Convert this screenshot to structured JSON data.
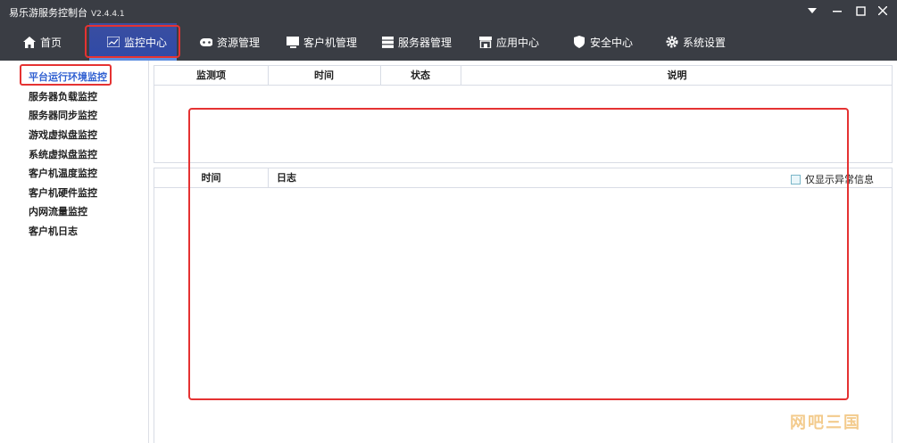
{
  "app": {
    "title": "易乐游服务控制台",
    "version": "V2.4.4.1"
  },
  "nav": {
    "home": "首页",
    "monitor": "监控中心",
    "resources": "资源管理",
    "clients": "客户机管理",
    "servers": "服务器管理",
    "apps": "应用中心",
    "security": "安全中心",
    "settings": "系统设置"
  },
  "sidebar": {
    "items": [
      "平台运行环境监控",
      "服务器负载监控",
      "服务器同步监控",
      "游戏虚拟盘监控",
      "系统虚拟盘监控",
      "客户机温度监控",
      "客户机硬件监控",
      "内网流量监控",
      "客户机日志"
    ]
  },
  "monitor_table": {
    "columns": [
      "监测项",
      "时间",
      "状态",
      "说明"
    ]
  },
  "log_table": {
    "columns": [
      "时间",
      "日志"
    ],
    "filter_label": "仅显示异常信息"
  },
  "watermark": "网吧三国",
  "colors": {
    "titlebar": "#3a3d44",
    "accent": "#2f5fd1",
    "highlight": "#e53232"
  }
}
